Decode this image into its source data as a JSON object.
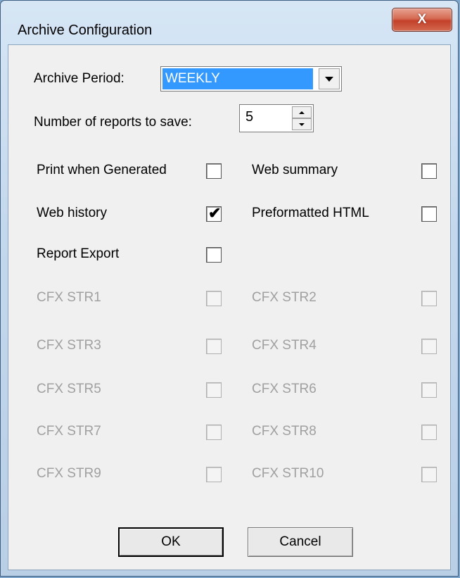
{
  "window": {
    "title": "Archive Configuration",
    "close_label": "X"
  },
  "archive_period": {
    "label": "Archive Period:",
    "value": "WEEKLY"
  },
  "reports_to_save": {
    "label": "Number of reports to save:",
    "value": "5"
  },
  "options": {
    "print_when_generated": {
      "label": "Print when Generated",
      "checked": false
    },
    "web_summary": {
      "label": "Web summary",
      "checked": false
    },
    "web_history": {
      "label": "Web history",
      "checked": true,
      "check_mark": "✔"
    },
    "preformatted_html": {
      "label": "Preformatted HTML",
      "checked": false
    },
    "report_export": {
      "label": "Report Export",
      "checked": false
    }
  },
  "cfx": [
    {
      "label": "CFX STR1"
    },
    {
      "label": "CFX STR2"
    },
    {
      "label": "CFX STR3"
    },
    {
      "label": "CFX STR4"
    },
    {
      "label": "CFX STR5"
    },
    {
      "label": "CFX STR6"
    },
    {
      "label": "CFX STR7"
    },
    {
      "label": "CFX STR8"
    },
    {
      "label": "CFX STR9"
    },
    {
      "label": "CFX STR10"
    }
  ],
  "buttons": {
    "ok": "OK",
    "cancel": "Cancel"
  }
}
